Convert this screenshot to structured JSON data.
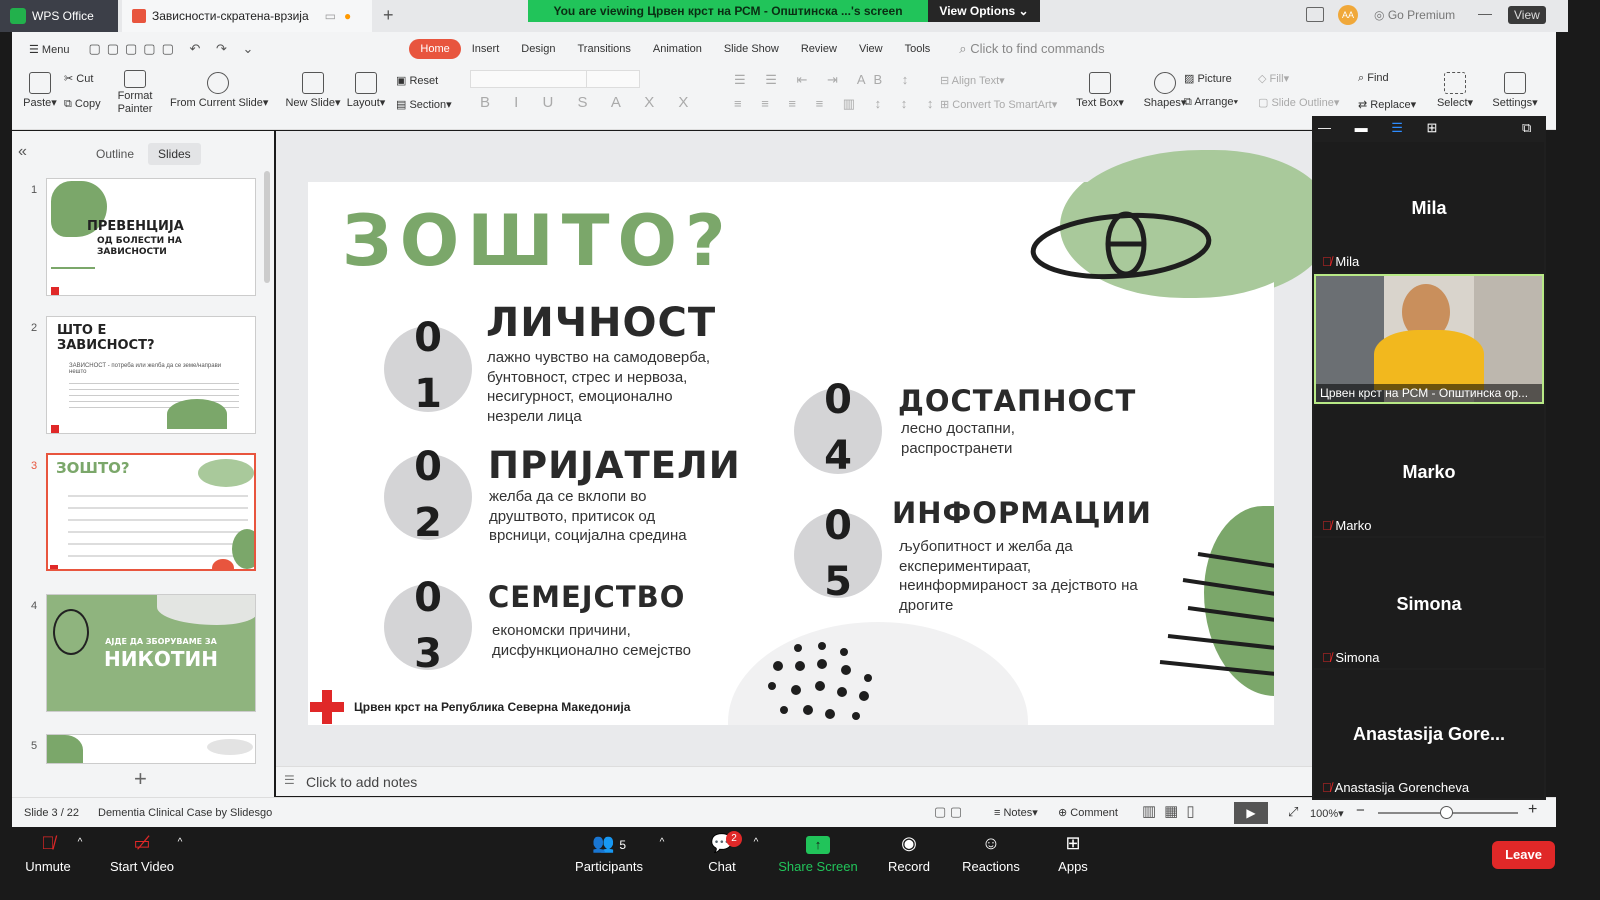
{
  "titlebar": {
    "app_tab": "WPS Office",
    "doc_tab": "Зависности-скратена-врзија",
    "share_text": "You are viewing Црвен крст на РСМ - Општинска ...'s screen",
    "view_options": "View Options",
    "go_premium": "Go Premium",
    "avatar_initials": "AA",
    "view_btn": "View"
  },
  "menu": {
    "menu_label": "Menu",
    "tabs": [
      "Home",
      "Insert",
      "Design",
      "Transitions",
      "Animation",
      "Slide Show",
      "Review",
      "View",
      "Tools"
    ],
    "search": "Click to find commands"
  },
  "toolbar": {
    "paste": "Paste",
    "cut": "Cut",
    "copy": "Copy",
    "format_painter": "Format Painter",
    "from_current": "From Current Slide",
    "new_slide": "New Slide",
    "layout": "Layout",
    "reset": "Reset",
    "section": "Section",
    "align_text": "Align Text",
    "convert_smartart": "Convert To SmartArt",
    "text_box": "Text Box",
    "shapes": "Shapes",
    "picture": "Picture",
    "arrange": "Arrange",
    "fill": "Fill",
    "slide_outline": "Slide Outline",
    "find": "Find",
    "replace": "Replace",
    "select": "Select",
    "settings": "Settings"
  },
  "panel": {
    "tab_outline": "Outline",
    "tab_slides": "Slides",
    "thumbs": [
      {
        "num": "1",
        "title": "ПРЕВЕНЦИЈА",
        "sub": "ОД БОЛЕСТИ НА ЗАВИСНОСТИ"
      },
      {
        "num": "2",
        "title": "ШТО Е ЗАВИСНОСТ?",
        "sub": "ЗАВИСНОСТ - потреба или желба да се земе/направи нешто"
      },
      {
        "num": "3",
        "title": "ЗОШТО?",
        "sub": ""
      },
      {
        "num": "4",
        "title": "НИКОТИН",
        "sub": "АЈДЕ ДА ЗБОРУВАМЕ ЗА"
      },
      {
        "num": "5",
        "title": "",
        "sub": ""
      }
    ]
  },
  "slide": {
    "title": "ЗОШТО?",
    "items": [
      {
        "d1": "0",
        "d2": "1",
        "heading": "ЛИЧНОСТ",
        "desc": [
          "лажно чувство на самодоверба,",
          "бунтовност, стрес и нервоза,",
          "несигурност, емоционално",
          "незрели лица"
        ]
      },
      {
        "d1": "0",
        "d2": "2",
        "heading": "ПРИЈАТЕЛИ",
        "desc": [
          "желба да се вклопи во",
          "друштвото, притисок од",
          "врсници, социјална средина"
        ]
      },
      {
        "d1": "0",
        "d2": "3",
        "heading": "СЕМЕЈСТВО",
        "desc": [
          "економски причини,",
          "дисфункционално семејство"
        ]
      },
      {
        "d1": "0",
        "d2": "4",
        "heading": "ДОСТАПНОСТ",
        "desc": [
          "лесно достапни,",
          "распространети"
        ]
      },
      {
        "d1": "0",
        "d2": "5",
        "heading": "ИНФОРМАЦИИ",
        "desc": [
          "љубопитност и желба да",
          "експериментираат,",
          "неинформираност за дејството на",
          "дрогите"
        ]
      }
    ],
    "footer": "Црвен крст на Република Северна Македонија"
  },
  "notes_placeholder": "Click to add notes",
  "status": {
    "slide_counter": "Slide 3 / 22",
    "theme": "Dementia Clinical Case by Slidesgo",
    "notes": "Notes",
    "comment": "Comment",
    "zoom": "100%"
  },
  "participants_panel": [
    {
      "name": "Mila",
      "label": "Mila",
      "video": false
    },
    {
      "name": "",
      "label": "Црвен крст на РСМ - Општинска ор...",
      "video": true
    },
    {
      "name": "Marko",
      "label": "Marko",
      "video": false
    },
    {
      "name": "Simona",
      "label": "Simona",
      "video": false
    },
    {
      "name": "Anastasija  Gore...",
      "label": "Anastasija Gorencheva",
      "video": false
    }
  ],
  "zoom_controls": {
    "unmute": "Unmute",
    "start_video": "Start Video",
    "participants": "Participants",
    "participant_count": "5",
    "chat": "Chat",
    "chat_badge": "2",
    "share_screen": "Share Screen",
    "record": "Record",
    "reactions": "Reactions",
    "apps": "Apps",
    "leave": "Leave"
  },
  "colors": {
    "accent_green": "#7ba76a",
    "wps_orange": "#e8553e",
    "zoom_green": "#21c45a",
    "leave_red": "#e02828"
  }
}
